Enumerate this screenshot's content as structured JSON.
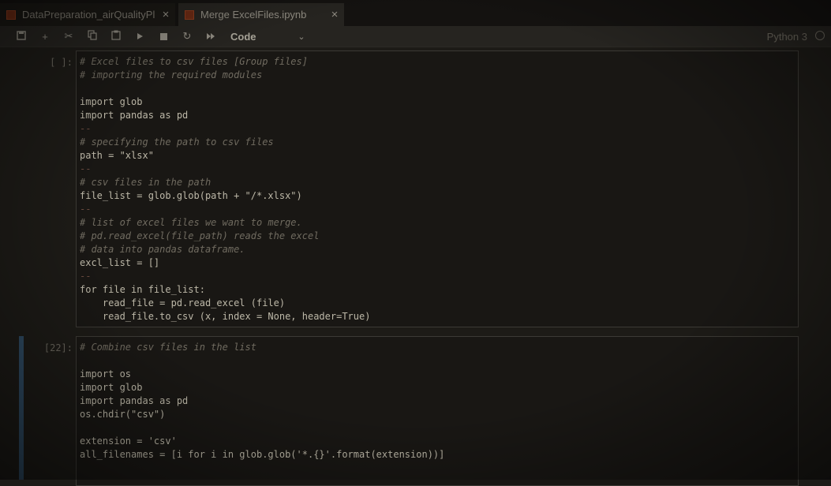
{
  "tabs": [
    {
      "title": "DataPreparation_airQualityPl",
      "close": "×"
    },
    {
      "title": "Merge ExcelFiles.ipynb",
      "close": "×"
    }
  ],
  "toolbar": {
    "icons": [
      "save-icon",
      "add-icon",
      "cut-icon",
      "copy-icon",
      "paste-icon",
      "run-icon",
      "stop-icon",
      "restart-icon",
      "run-all-icon"
    ],
    "cell_type": "Code",
    "kernel": "Python 3"
  },
  "cells": [
    {
      "prompt": "[ ]:",
      "lines": [
        "# Excel files to csv files [Group files]",
        "# importing the required modules",
        "",
        "import glob",
        "import pandas as pd",
        "--",
        "# specifying the path to csv files",
        "path = \"xlsx\"",
        "--",
        "# csv files in the path",
        "file_list = glob.glob(path + \"/*.xlsx\")",
        "--",
        "# list of excel files we want to merge.",
        "# pd.read_excel(file_path) reads the excel",
        "# data into pandas dataframe.",
        "excl_list = []",
        "--",
        "for file in file_list:",
        "    read_file = pd.read_excel (file)",
        "    read_file.to_csv (x, index = None, header=True)"
      ]
    },
    {
      "prompt": "[22]:",
      "lines": [
        "# Combine csv files in the list",
        "",
        "import os",
        "import glob",
        "import pandas as pd",
        "os.chdir(\"csv\")",
        "",
        "extension = 'csv'",
        "all_filenames = [i for i in glob.glob('*.{}'.format(extension))]"
      ]
    }
  ]
}
